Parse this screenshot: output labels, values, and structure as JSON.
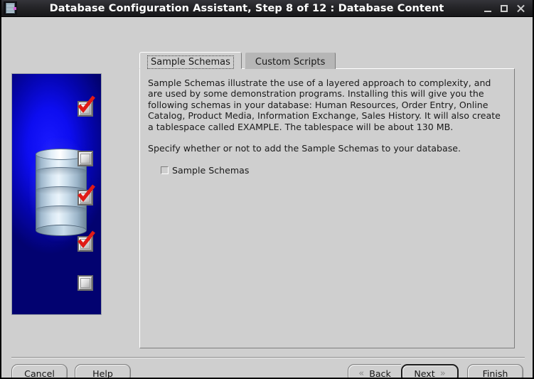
{
  "window": {
    "title": "Database Configuration Assistant, Step 8 of 12 : Database Content",
    "icon": "database-app-icon",
    "controls": {
      "minimize": "minimize-icon",
      "maximize": "maximize-icon",
      "close": "close-icon"
    }
  },
  "sidebar": {
    "illustration": "database-cylinder-with-checkmarks",
    "background_color": "#0d0df0",
    "marks": [
      {
        "state": "checked"
      },
      {
        "state": "unchecked"
      },
      {
        "state": "checked"
      },
      {
        "state": "checked"
      },
      {
        "state": "unchecked"
      }
    ],
    "check_color": "#e01b16"
  },
  "tabs": [
    {
      "label": "Sample Schemas",
      "selected": true
    },
    {
      "label": "Custom Scripts",
      "selected": false
    }
  ],
  "panel": {
    "paragraph1": "Sample Schemas illustrate the use of a layered approach to complexity, and are used by some demonstration programs. Installing this will give you the following schemas in your database: Human Resources, Order Entry, Online Catalog, Product Media, Information Exchange, Sales History. It will also create a tablespace called EXAMPLE. The tablespace will be about 130 MB.",
    "paragraph2": "Specify whether or not to add the Sample Schemas to your database.",
    "checkbox": {
      "label": "Sample Schemas",
      "checked": false
    }
  },
  "buttons": {
    "cancel": "Cancel",
    "help": "Help",
    "back": "Back",
    "back_mnemonic": "B",
    "next": "Next",
    "next_mnemonic": "N",
    "finish": "Finish",
    "finish_mnemonic": "F",
    "back_arrow": "«",
    "next_arrow": "»",
    "default_button": "Next"
  }
}
